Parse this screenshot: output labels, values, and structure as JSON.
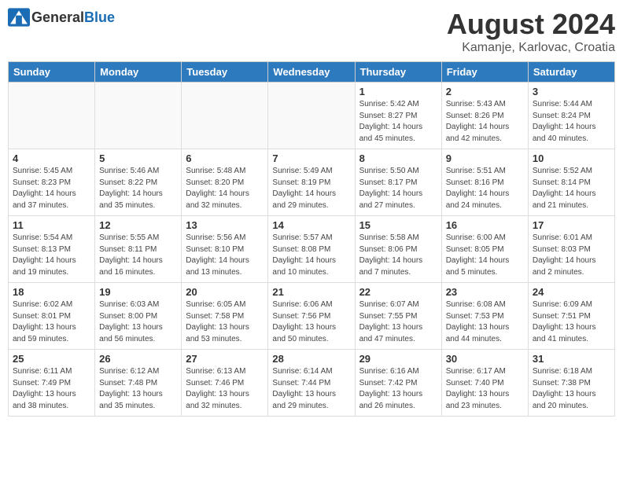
{
  "header": {
    "logo_general": "General",
    "logo_blue": "Blue",
    "title": "August 2024",
    "location": "Kamanje, Karlovac, Croatia"
  },
  "days_of_week": [
    "Sunday",
    "Monday",
    "Tuesday",
    "Wednesday",
    "Thursday",
    "Friday",
    "Saturday"
  ],
  "weeks": [
    [
      {
        "date": "",
        "info": ""
      },
      {
        "date": "",
        "info": ""
      },
      {
        "date": "",
        "info": ""
      },
      {
        "date": "",
        "info": ""
      },
      {
        "date": "1",
        "info": "Sunrise: 5:42 AM\nSunset: 8:27 PM\nDaylight: 14 hours\nand 45 minutes."
      },
      {
        "date": "2",
        "info": "Sunrise: 5:43 AM\nSunset: 8:26 PM\nDaylight: 14 hours\nand 42 minutes."
      },
      {
        "date": "3",
        "info": "Sunrise: 5:44 AM\nSunset: 8:24 PM\nDaylight: 14 hours\nand 40 minutes."
      }
    ],
    [
      {
        "date": "4",
        "info": "Sunrise: 5:45 AM\nSunset: 8:23 PM\nDaylight: 14 hours\nand 37 minutes."
      },
      {
        "date": "5",
        "info": "Sunrise: 5:46 AM\nSunset: 8:22 PM\nDaylight: 14 hours\nand 35 minutes."
      },
      {
        "date": "6",
        "info": "Sunrise: 5:48 AM\nSunset: 8:20 PM\nDaylight: 14 hours\nand 32 minutes."
      },
      {
        "date": "7",
        "info": "Sunrise: 5:49 AM\nSunset: 8:19 PM\nDaylight: 14 hours\nand 29 minutes."
      },
      {
        "date": "8",
        "info": "Sunrise: 5:50 AM\nSunset: 8:17 PM\nDaylight: 14 hours\nand 27 minutes."
      },
      {
        "date": "9",
        "info": "Sunrise: 5:51 AM\nSunset: 8:16 PM\nDaylight: 14 hours\nand 24 minutes."
      },
      {
        "date": "10",
        "info": "Sunrise: 5:52 AM\nSunset: 8:14 PM\nDaylight: 14 hours\nand 21 minutes."
      }
    ],
    [
      {
        "date": "11",
        "info": "Sunrise: 5:54 AM\nSunset: 8:13 PM\nDaylight: 14 hours\nand 19 minutes."
      },
      {
        "date": "12",
        "info": "Sunrise: 5:55 AM\nSunset: 8:11 PM\nDaylight: 14 hours\nand 16 minutes."
      },
      {
        "date": "13",
        "info": "Sunrise: 5:56 AM\nSunset: 8:10 PM\nDaylight: 14 hours\nand 13 minutes."
      },
      {
        "date": "14",
        "info": "Sunrise: 5:57 AM\nSunset: 8:08 PM\nDaylight: 14 hours\nand 10 minutes."
      },
      {
        "date": "15",
        "info": "Sunrise: 5:58 AM\nSunset: 8:06 PM\nDaylight: 14 hours\nand 7 minutes."
      },
      {
        "date": "16",
        "info": "Sunrise: 6:00 AM\nSunset: 8:05 PM\nDaylight: 14 hours\nand 5 minutes."
      },
      {
        "date": "17",
        "info": "Sunrise: 6:01 AM\nSunset: 8:03 PM\nDaylight: 14 hours\nand 2 minutes."
      }
    ],
    [
      {
        "date": "18",
        "info": "Sunrise: 6:02 AM\nSunset: 8:01 PM\nDaylight: 13 hours\nand 59 minutes."
      },
      {
        "date": "19",
        "info": "Sunrise: 6:03 AM\nSunset: 8:00 PM\nDaylight: 13 hours\nand 56 minutes."
      },
      {
        "date": "20",
        "info": "Sunrise: 6:05 AM\nSunset: 7:58 PM\nDaylight: 13 hours\nand 53 minutes."
      },
      {
        "date": "21",
        "info": "Sunrise: 6:06 AM\nSunset: 7:56 PM\nDaylight: 13 hours\nand 50 minutes."
      },
      {
        "date": "22",
        "info": "Sunrise: 6:07 AM\nSunset: 7:55 PM\nDaylight: 13 hours\nand 47 minutes."
      },
      {
        "date": "23",
        "info": "Sunrise: 6:08 AM\nSunset: 7:53 PM\nDaylight: 13 hours\nand 44 minutes."
      },
      {
        "date": "24",
        "info": "Sunrise: 6:09 AM\nSunset: 7:51 PM\nDaylight: 13 hours\nand 41 minutes."
      }
    ],
    [
      {
        "date": "25",
        "info": "Sunrise: 6:11 AM\nSunset: 7:49 PM\nDaylight: 13 hours\nand 38 minutes."
      },
      {
        "date": "26",
        "info": "Sunrise: 6:12 AM\nSunset: 7:48 PM\nDaylight: 13 hours\nand 35 minutes."
      },
      {
        "date": "27",
        "info": "Sunrise: 6:13 AM\nSunset: 7:46 PM\nDaylight: 13 hours\nand 32 minutes."
      },
      {
        "date": "28",
        "info": "Sunrise: 6:14 AM\nSunset: 7:44 PM\nDaylight: 13 hours\nand 29 minutes."
      },
      {
        "date": "29",
        "info": "Sunrise: 6:16 AM\nSunset: 7:42 PM\nDaylight: 13 hours\nand 26 minutes."
      },
      {
        "date": "30",
        "info": "Sunrise: 6:17 AM\nSunset: 7:40 PM\nDaylight: 13 hours\nand 23 minutes."
      },
      {
        "date": "31",
        "info": "Sunrise: 6:18 AM\nSunset: 7:38 PM\nDaylight: 13 hours\nand 20 minutes."
      }
    ]
  ]
}
